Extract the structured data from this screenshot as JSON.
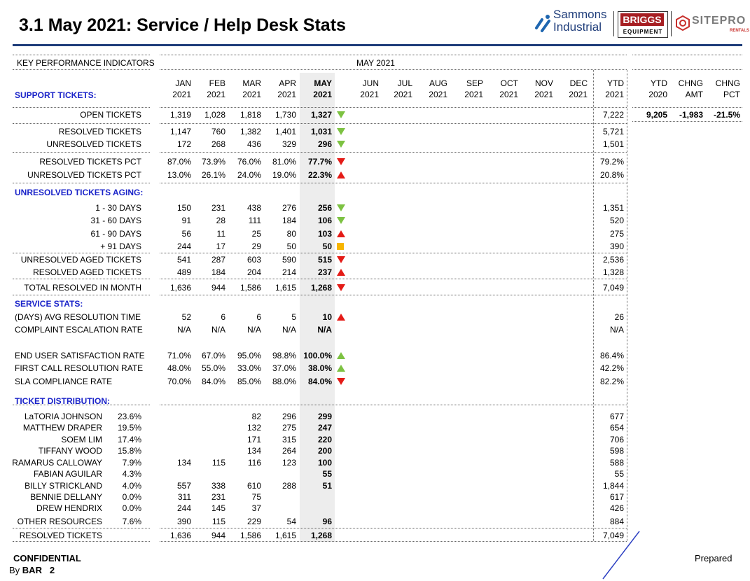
{
  "title": "3.1  May 2021: Service / Help Desk Stats",
  "logos": {
    "sammons_line1": "Sammons",
    "sammons_line2": "Industrial",
    "briggs": "BRIGGS",
    "briggs_sub": "EQUIPMENT",
    "sitepro": "SITEPRO",
    "sitepro_sub": "RENTALS"
  },
  "header": {
    "kpi": "KEY PERFORMANCE INDICATORS",
    "period": "MAY 2021"
  },
  "months": [
    {
      "m": "JAN",
      "y": "2021"
    },
    {
      "m": "FEB",
      "y": "2021"
    },
    {
      "m": "MAR",
      "y": "2021"
    },
    {
      "m": "APR",
      "y": "2021"
    },
    {
      "m": "MAY",
      "y": "2021"
    },
    {
      "m": "JUN",
      "y": "2021"
    },
    {
      "m": "JUL",
      "y": "2021"
    },
    {
      "m": "AUG",
      "y": "2021"
    },
    {
      "m": "SEP",
      "y": "2021"
    },
    {
      "m": "OCT",
      "y": "2021"
    },
    {
      "m": "NOV",
      "y": "2021"
    },
    {
      "m": "DEC",
      "y": "2021"
    },
    {
      "m": "YTD",
      "y": "2021"
    }
  ],
  "right_headers": [
    {
      "a": "YTD",
      "b": "2020"
    },
    {
      "a": "CHNG",
      "b": "AMT"
    },
    {
      "a": "CHNG",
      "b": "PCT"
    }
  ],
  "sections": {
    "support": "SUPPORT TICKETS:",
    "aging": "UNRESOLVED TICKETS AGING:",
    "service": "SERVICE STATS:",
    "distribution": "TICKET DISTRIBUTION:"
  },
  "rows": [
    {
      "label": "OPEN TICKETS",
      "jan": "1,319",
      "feb": "1,028",
      "mar": "1,818",
      "apr": "1,730",
      "may": "1,327",
      "ind": "down-green",
      "ytd": "7,222"
    },
    {
      "label": "RESOLVED TICKETS",
      "jan": "1,147",
      "feb": "760",
      "mar": "1,382",
      "apr": "1,401",
      "may": "1,031",
      "ind": "down-green",
      "ytd": "5,721"
    },
    {
      "label": "UNRESOLVED TICKETS",
      "jan": "172",
      "feb": "268",
      "mar": "436",
      "apr": "329",
      "may": "296",
      "ind": "down-green",
      "ytd": "1,501"
    },
    {
      "label": "RESOLVED TICKETS PCT",
      "jan": "87.0%",
      "feb": "73.9%",
      "mar": "76.0%",
      "apr": "81.0%",
      "may": "77.7%",
      "ind": "down-red",
      "ytd": "79.2%"
    },
    {
      "label": "UNRESOLVED TICKETS PCT",
      "jan": "13.0%",
      "feb": "26.1%",
      "mar": "24.0%",
      "apr": "19.0%",
      "may": "22.3%",
      "ind": "up-red",
      "ytd": "20.8%"
    },
    {
      "label": "1 - 30 DAYS",
      "jan": "150",
      "feb": "231",
      "mar": "438",
      "apr": "276",
      "may": "256",
      "ind": "down-green",
      "ytd": "1,351"
    },
    {
      "label": "31 - 60 DAYS",
      "jan": "91",
      "feb": "28",
      "mar": "111",
      "apr": "184",
      "may": "106",
      "ind": "down-green",
      "ytd": "520"
    },
    {
      "label": "61 - 90 DAYS",
      "jan": "56",
      "feb": "11",
      "mar": "25",
      "apr": "80",
      "may": "103",
      "ind": "up-red",
      "ytd": "275"
    },
    {
      "label": "+ 91 DAYS",
      "jan": "244",
      "feb": "17",
      "mar": "29",
      "apr": "50",
      "may": "50",
      "ind": "square-yellow",
      "ytd": "390"
    },
    {
      "label": "UNRESOLVED AGED TICKETS",
      "jan": "541",
      "feb": "287",
      "mar": "603",
      "apr": "590",
      "may": "515",
      "ind": "down-red",
      "ytd": "2,536"
    },
    {
      "label": "RESOLVED AGED TICKETS",
      "jan": "489",
      "feb": "184",
      "mar": "204",
      "apr": "214",
      "may": "237",
      "ind": "up-red",
      "ytd": "1,328"
    },
    {
      "label": "TOTAL RESOLVED IN MONTH",
      "jan": "1,636",
      "feb": "944",
      "mar": "1,586",
      "apr": "1,615",
      "may": "1,268",
      "ind": "down-red",
      "ytd": "7,049"
    },
    {
      "label": "(DAYS) AVG RESOLUTION TIME",
      "jan": "52",
      "feb": "6",
      "mar": "6",
      "apr": "5",
      "may": "10",
      "ind": "up-red",
      "ytd": "26"
    },
    {
      "label": "COMPLAINT ESCALATION RATE",
      "jan": "N/A",
      "feb": "N/A",
      "mar": "N/A",
      "apr": "N/A",
      "may": "N/A",
      "ind": "",
      "ytd": "N/A"
    },
    {
      "label": "END USER SATISFACTION RATE",
      "jan": "71.0%",
      "feb": "67.0%",
      "mar": "95.0%",
      "apr": "98.8%",
      "may": "100.0%",
      "ind": "up-green",
      "ytd": "86.4%"
    },
    {
      "label": "FIRST CALL RESOLUTION RATE",
      "jan": "48.0%",
      "feb": "55.0%",
      "mar": "33.0%",
      "apr": "37.0%",
      "may": "38.0%",
      "ind": "up-green",
      "ytd": "42.2%"
    },
    {
      "label": "SLA COMPLIANCE RATE",
      "jan": "70.0%",
      "feb": "84.0%",
      "mar": "85.0%",
      "apr": "88.0%",
      "may": "84.0%",
      "ind": "down-red",
      "ytd": "82.2%"
    }
  ],
  "open_right": {
    "ytd2020": "9,205",
    "chng_amt": "-1,983",
    "chng_pct": "-21.5%"
  },
  "distribution": [
    {
      "name": "LaTORIA JOHNSON",
      "pct": "23.6%",
      "jan": "",
      "feb": "",
      "mar": "82",
      "apr": "296",
      "may": "299",
      "ytd": "677"
    },
    {
      "name": "MATTHEW DRAPER",
      "pct": "19.5%",
      "jan": "",
      "feb": "",
      "mar": "132",
      "apr": "275",
      "may": "247",
      "ytd": "654"
    },
    {
      "name": "SOEM LIM",
      "pct": "17.4%",
      "jan": "",
      "feb": "",
      "mar": "171",
      "apr": "315",
      "may": "220",
      "ytd": "706"
    },
    {
      "name": "TIFFANY WOOD",
      "pct": "15.8%",
      "jan": "",
      "feb": "",
      "mar": "134",
      "apr": "264",
      "may": "200",
      "ytd": "598"
    },
    {
      "name": "RAMARUS CALLOWAY",
      "pct": "7.9%",
      "jan": "134",
      "feb": "115",
      "mar": "116",
      "apr": "123",
      "may": "100",
      "ytd": "588"
    },
    {
      "name": "FABIAN AGUILAR",
      "pct": "4.3%",
      "jan": "",
      "feb": "",
      "mar": "",
      "apr": "",
      "may": "55",
      "ytd": "55"
    },
    {
      "name": "BILLY STRICKLAND",
      "pct": "4.0%",
      "jan": "557",
      "feb": "338",
      "mar": "610",
      "apr": "288",
      "may": "51",
      "ytd": "1,844"
    },
    {
      "name": "BENNIE DELLANY",
      "pct": "0.0%",
      "jan": "311",
      "feb": "231",
      "mar": "75",
      "apr": "",
      "may": "",
      "ytd": "617"
    },
    {
      "name": "DREW HENDRIX",
      "pct": "0.0%",
      "jan": "244",
      "feb": "145",
      "mar": "37",
      "apr": "",
      "may": "",
      "ytd": "426"
    },
    {
      "name": "OTHER RESOURCES",
      "pct": "7.6%",
      "jan": "390",
      "feb": "115",
      "mar": "229",
      "apr": "54",
      "may": "96",
      "ytd": "884"
    }
  ],
  "dist_total": {
    "label": "RESOLVED TICKETS",
    "jan": "1,636",
    "feb": "944",
    "mar": "1,586",
    "apr": "1,615",
    "may": "1,268",
    "ytd": "7,049"
  },
  "footer": {
    "confidential": "CONFIDENTIAL",
    "by": "By",
    "by_bold": "BAR",
    "page": "2",
    "prepared": "Prepared"
  },
  "colors": {
    "rule": "#1f3d7a",
    "section": "#1a23c9",
    "green": "#7dc242",
    "red": "#e41b17",
    "yellow": "#f7b500",
    "briggs": "#a61e22"
  }
}
